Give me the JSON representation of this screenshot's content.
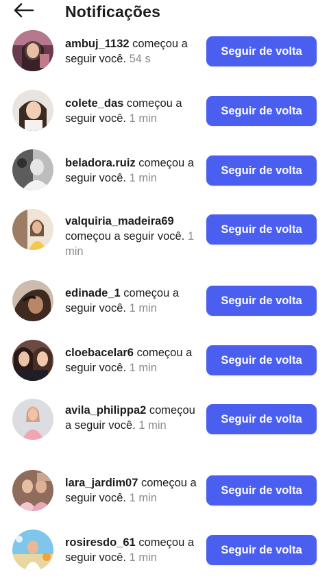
{
  "header": {
    "title": "Notificações",
    "back_icon": "arrow-left-icon"
  },
  "notifications": [
    {
      "username": "ambuj_1132",
      "action": " começou a seguir você.",
      "time": "54 s",
      "button": "Seguir de volta"
    },
    {
      "username": "colete_das",
      "action": " começou a seguir você.",
      "time": "1 min",
      "button": "Seguir de volta"
    },
    {
      "username": "beladora.ruiz",
      "action": " começou a seguir você.",
      "time": "1 min",
      "button": "Seguir de volta"
    },
    {
      "username": "valquiria_madeira69",
      "action": " começou a seguir você.",
      "time": "1 min",
      "button": "Seguir de volta"
    },
    {
      "username": "edinade_1",
      "action": " começou a seguir você.",
      "time": "1 min",
      "button": "Seguir de volta"
    },
    {
      "username": "cloebacelar6",
      "action": " começou a seguir você.",
      "time": "1 min",
      "button": "Seguir de volta"
    },
    {
      "username": "avila_philippa2",
      "action": " começou a seguir você.",
      "time": "1 min",
      "button": "Seguir de volta"
    },
    {
      "username": "lara_jardim07",
      "action": " começou a seguir você.",
      "time": "1 min",
      "button": "Seguir de volta"
    },
    {
      "username": "rosiresdo_61",
      "action": " começou a seguir você.",
      "time": "1 min",
      "button": "Seguir de volta"
    }
  ],
  "colors": {
    "accent": "#4a5ff0",
    "time_text": "#8a8a8e"
  }
}
